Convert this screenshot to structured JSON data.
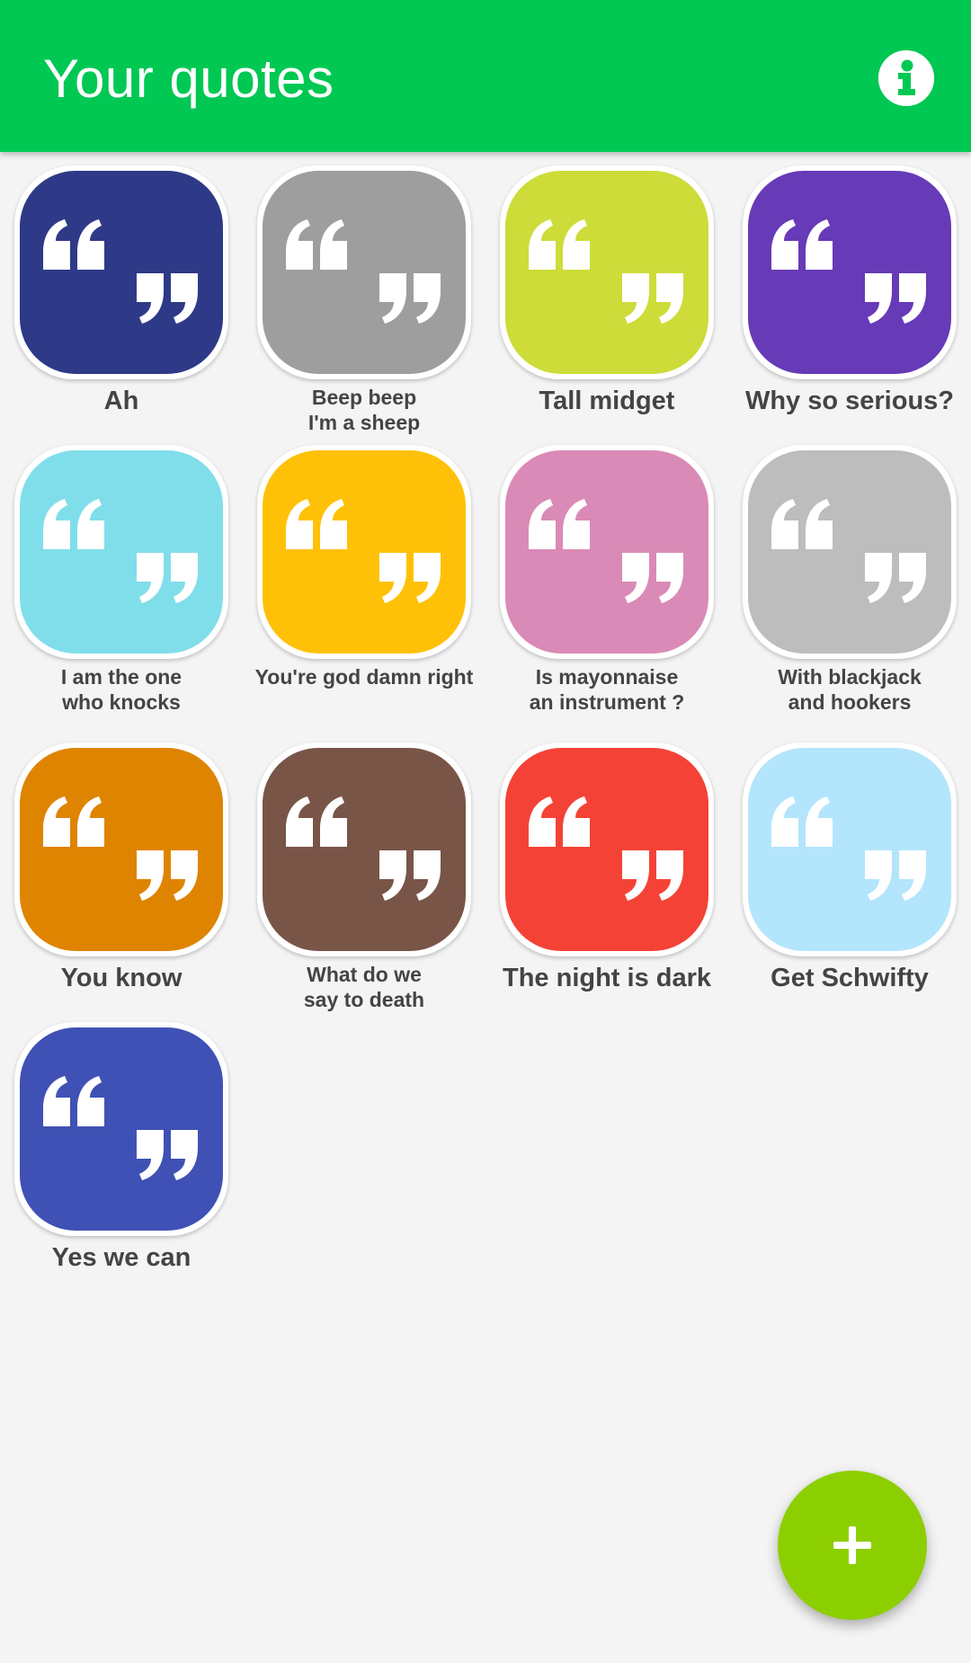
{
  "app_bar": {
    "title": "Your quotes",
    "info_icon": "info-icon",
    "color": "#00c853"
  },
  "quotes": [
    {
      "label": "Ah",
      "color": "#2e3a87",
      "size": "big"
    },
    {
      "label": "Beep beep\nI'm a sheep",
      "color": "#9e9e9e",
      "size": "small"
    },
    {
      "label": "Tall midget",
      "color": "#cddc39",
      "size": "big"
    },
    {
      "label": "Why so serious?",
      "color": "#673ab7",
      "size": "big"
    },
    {
      "label": "I am the one\nwho knocks",
      "color": "#80deea",
      "size": "small"
    },
    {
      "label": "You're god damn right",
      "color": "#ffc107",
      "size": "small"
    },
    {
      "label": "Is mayonnaise\nan instrument ?",
      "color": "#da8ab6",
      "size": "small"
    },
    {
      "label": "With blackjack\nand hookers",
      "color": "#bdbdbd",
      "size": "small"
    },
    {
      "label": "You know",
      "color": "#df8400",
      "size": "big"
    },
    {
      "label": "What do we\nsay to death",
      "color": "#795548",
      "size": "small"
    },
    {
      "label": "The night is dark",
      "color": "#f44336",
      "size": "big"
    },
    {
      "label": "Get Schwifty",
      "color": "#b3e5fc",
      "size": "big"
    },
    {
      "label": "Yes we can",
      "color": "#3f51b5",
      "size": "big"
    }
  ],
  "quote_icon": "quote-marks-icon",
  "fab": {
    "icon": "plus-icon",
    "color": "#8ccf00"
  }
}
